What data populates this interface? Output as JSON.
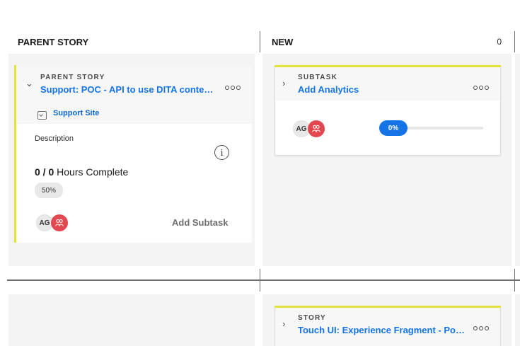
{
  "columns": [
    {
      "title": "PARENT STORY"
    },
    {
      "title": "NEW",
      "count": "0"
    }
  ],
  "parent_card": {
    "type_label": "PARENT STORY",
    "title": "Support: POC - API to use DITA content...",
    "project_link": "Support Site",
    "description_label": "Description",
    "hours_done": "0",
    "hours_sep": " / ",
    "hours_total": "0",
    "hours_label": " Hours Complete",
    "percent_label": "50%",
    "percent_value": 50,
    "avatar_initials": "AG",
    "add_subtask_label": "Add Subtask"
  },
  "subtask_card": {
    "type_label": "SUBTASK",
    "title": "Add Analytics",
    "avatar_initials": "AG",
    "progress_label": "0%",
    "progress_value": 0
  },
  "story_card": {
    "type_label": "STORY",
    "title": "Touch UI: Experience Fragment - Port ..."
  },
  "colors": {
    "accent_yellow": "#e1e23a",
    "link_blue": "#1473e6",
    "team_avatar": "#e34850",
    "lane_bg": "#f4f4f4"
  }
}
